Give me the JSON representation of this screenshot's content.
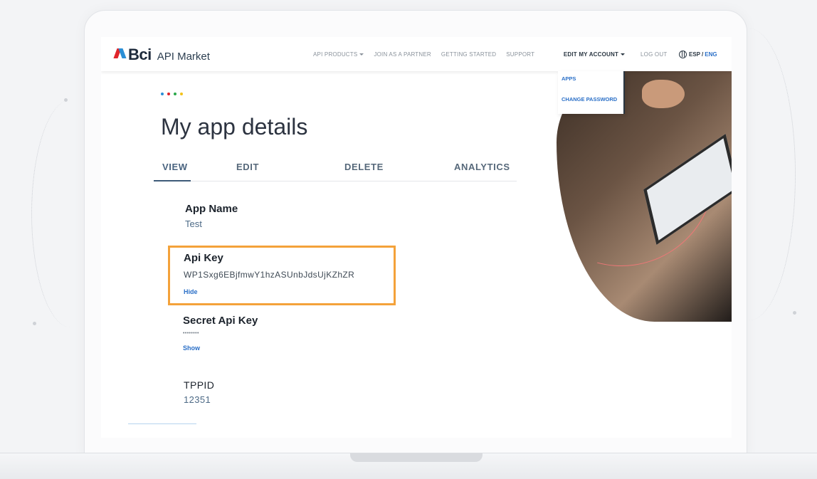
{
  "navbar": {
    "brand": "Bci",
    "product": "API Market",
    "links": {
      "api_products": "API PRODUCTS",
      "join_partner": "JOIN AS A PARTNER",
      "getting_started": "GETTING STARTED",
      "support": "SUPPORT",
      "edit_account": "EDIT MY ACCOUNT",
      "logout": "LOG OUT"
    },
    "lang_esp": "ESP",
    "lang_sep": "/",
    "lang_eng": "ENG"
  },
  "dropdown": {
    "items": [
      "APPS",
      "CHANGE PASSWORD"
    ]
  },
  "page": {
    "title": "My app details",
    "dot_colors": [
      "#2a8fd6",
      "#e0252b",
      "#2aa84a",
      "#f2c21a"
    ]
  },
  "tabs": [
    "VIEW",
    "EDIT",
    "DELETE",
    "ANALYTICS"
  ],
  "details": {
    "app_name_label": "App Name",
    "app_name_value": "Test",
    "api_key_label": "Api Key",
    "api_key_value": "WP1Sxg6EBjfmwY1hzASUnbJdsUjKZhZR",
    "api_key_toggle": "Hide",
    "secret_label": "Secret Api Key",
    "secret_value": "••••••••",
    "secret_toggle": "Show",
    "tppid_label": "TPPID",
    "tppid_value": "12351"
  },
  "colors": {
    "highlight": "#f4a23a",
    "link": "#2a6fc7"
  }
}
